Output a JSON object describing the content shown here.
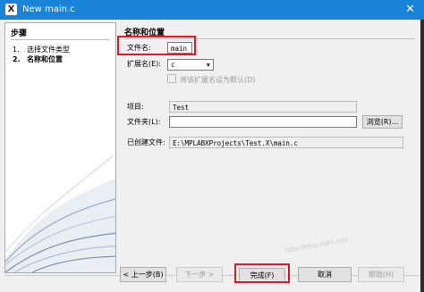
{
  "window": {
    "title": "New main.c",
    "close_glyph": "✕",
    "app_icon_glyph": "X"
  },
  "steps": {
    "header": "步骤",
    "items": [
      {
        "num": "1.",
        "label": "选择文件类型"
      },
      {
        "num": "2.",
        "label": "名称和位置"
      }
    ]
  },
  "panel": {
    "header": "名称和位置",
    "file_name_label": "文件名:",
    "file_name_value": "main",
    "extension_label": "扩展名(E):",
    "extension_value": "c",
    "default_checkbox_label": "将该扩展名设为默认(D)",
    "project_label": "项目:",
    "project_value": "Test",
    "folder_label": "文件夹(L):",
    "folder_value": "",
    "browse_label": "浏览(R)...",
    "created_file_label": "已创建文件:",
    "created_file_value": "E:\\MPLABXProjects\\Test.X\\main.c"
  },
  "buttons": {
    "back": "< 上一步(B)",
    "next": "下一步 >",
    "finish": "完成(F)",
    "cancel": "取消",
    "help": "帮助(H)"
  },
  "watermark": "http://blog.csdn.net/..."
}
